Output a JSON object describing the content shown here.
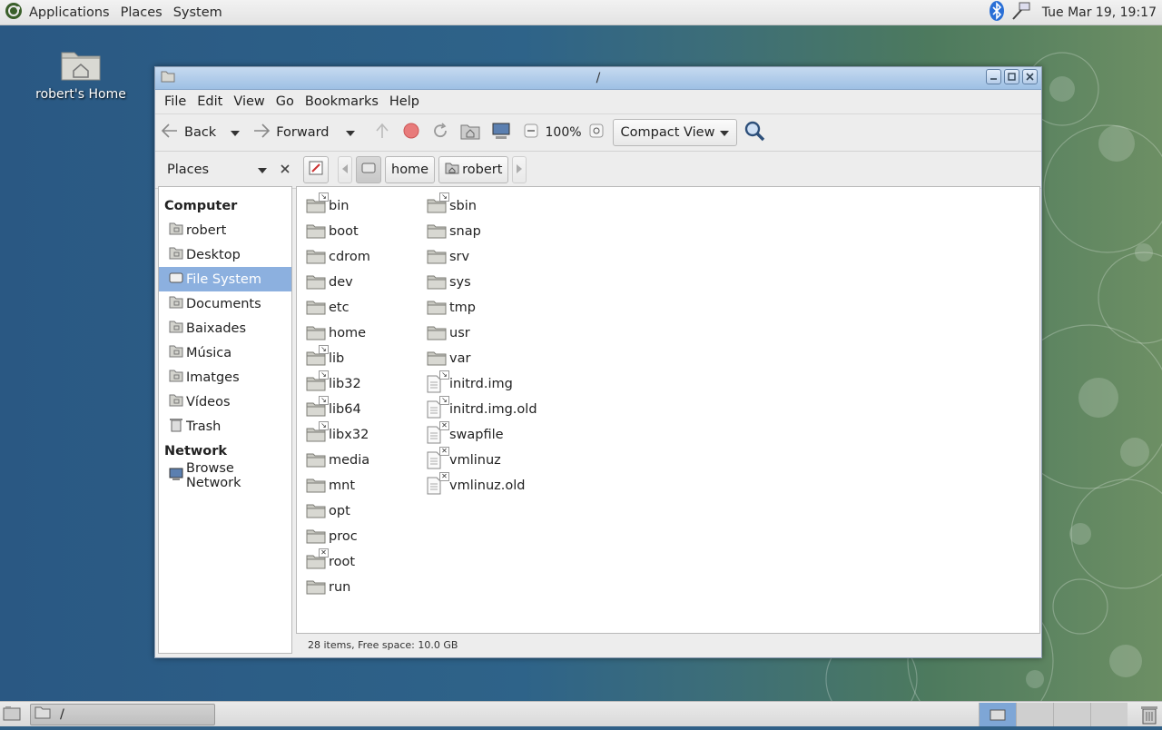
{
  "top_panel": {
    "menus": [
      "Applications",
      "Places",
      "System"
    ],
    "clock": "Tue Mar 19, 19:17",
    "icons": [
      "ubuntu-logo-icon",
      "bluetooth-icon",
      "network-icon"
    ]
  },
  "desktop": {
    "home_icon_label": "robert's Home"
  },
  "window": {
    "title": "/",
    "menus": [
      "File",
      "Edit",
      "View",
      "Go",
      "Bookmarks",
      "Help"
    ],
    "toolbar": {
      "back_label": "Back",
      "forward_label": "Forward",
      "zoom_level": "100%",
      "view_mode": "Compact View"
    },
    "location": {
      "places_label": "Places",
      "path": [
        "home",
        "robert"
      ]
    },
    "sidebar": {
      "computer_heading": "Computer",
      "network_heading": "Network",
      "computer_items": [
        {
          "label": "robert",
          "icon": "home-folder-icon"
        },
        {
          "label": "Desktop",
          "icon": "desktop-folder-icon"
        },
        {
          "label": "File System",
          "icon": "filesystem-icon",
          "active": true
        },
        {
          "label": "Documents",
          "icon": "documents-folder-icon"
        },
        {
          "label": "Baixades",
          "icon": "downloads-folder-icon"
        },
        {
          "label": "Música",
          "icon": "music-folder-icon"
        },
        {
          "label": "Imatges",
          "icon": "pictures-folder-icon"
        },
        {
          "label": "Vídeos",
          "icon": "videos-folder-icon"
        },
        {
          "label": "Trash",
          "icon": "trash-icon"
        }
      ],
      "network_items": [
        {
          "label": "Browse Network",
          "icon": "network-browse-icon"
        }
      ]
    },
    "files_col1": [
      {
        "name": "bin",
        "type": "folder",
        "emblem": "link"
      },
      {
        "name": "boot",
        "type": "folder"
      },
      {
        "name": "cdrom",
        "type": "folder"
      },
      {
        "name": "dev",
        "type": "folder"
      },
      {
        "name": "etc",
        "type": "folder"
      },
      {
        "name": "home",
        "type": "folder"
      },
      {
        "name": "lib",
        "type": "folder",
        "emblem": "link"
      },
      {
        "name": "lib32",
        "type": "folder",
        "emblem": "link"
      },
      {
        "name": "lib64",
        "type": "folder",
        "emblem": "link"
      },
      {
        "name": "libx32",
        "type": "folder",
        "emblem": "link"
      },
      {
        "name": "media",
        "type": "folder"
      },
      {
        "name": "mnt",
        "type": "folder"
      },
      {
        "name": "opt",
        "type": "folder"
      },
      {
        "name": "proc",
        "type": "folder"
      },
      {
        "name": "root",
        "type": "folder",
        "emblem": "locked"
      },
      {
        "name": "run",
        "type": "folder"
      }
    ],
    "files_col2": [
      {
        "name": "sbin",
        "type": "folder",
        "emblem": "link"
      },
      {
        "name": "snap",
        "type": "folder"
      },
      {
        "name": "srv",
        "type": "folder"
      },
      {
        "name": "sys",
        "type": "folder"
      },
      {
        "name": "tmp",
        "type": "folder"
      },
      {
        "name": "usr",
        "type": "folder"
      },
      {
        "name": "var",
        "type": "folder"
      },
      {
        "name": "initrd.img",
        "type": "file",
        "emblem": "link"
      },
      {
        "name": "initrd.img.old",
        "type": "file",
        "emblem": "link"
      },
      {
        "name": "swapfile",
        "type": "file",
        "emblem": "locked"
      },
      {
        "name": "vmlinuz",
        "type": "file",
        "emblem": "locked"
      },
      {
        "name": "vmlinuz.old",
        "type": "file",
        "emblem": "locked"
      }
    ],
    "status": "28 items, Free space: 10.0 GB"
  },
  "bottom_panel": {
    "task_label": "/"
  }
}
